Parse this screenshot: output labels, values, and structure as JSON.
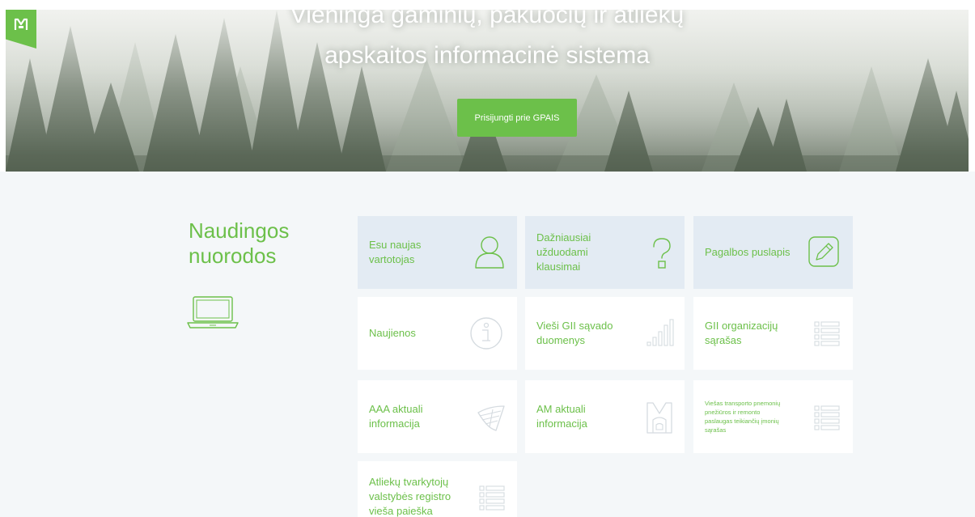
{
  "hero": {
    "title_line1": "Vieninga gaminių, pakuočių ir atliekų",
    "title_line2": "apskaitos informacinė sistema",
    "login_button": "Prisijungti prie GPAIS"
  },
  "logo": {
    "icon": "gpais-logo-icon"
  },
  "links_section": {
    "title": "Naudingos nuorodos",
    "icon": "laptop-icon",
    "cards": [
      {
        "label": "Esu naujas vartotojas",
        "icon": "user-icon",
        "highlighted": true
      },
      {
        "label": "Dažniausiai užduodami klausimai",
        "icon": "question-icon",
        "highlighted": true
      },
      {
        "label": "Pagalbos puslapis",
        "icon": "pencil-icon",
        "highlighted": true
      },
      {
        "label": "Naujienos",
        "icon": "info-icon",
        "highlighted": false
      },
      {
        "label": "Vieši GII sąvado duomenys",
        "icon": "bar-chart-icon",
        "highlighted": false
      },
      {
        "label": "GII organizacijų sąrašas",
        "icon": "list-icon",
        "highlighted": false
      },
      {
        "label": "AAA aktuali informacija",
        "icon": "aaa-logo-icon",
        "highlighted": false
      },
      {
        "label": "AM aktuali informacija",
        "icon": "am-logo-icon",
        "highlighted": false
      },
      {
        "label": "Viešas transporto pnemonių pnežiūros ir remonto paslaugas teikiančių įmonių sąrašas",
        "icon": "list-icon",
        "highlighted": false
      },
      {
        "label": "Atliekų tvarkytojų valstybės registro vieša paieška",
        "icon": "list-icon",
        "highlighted": false
      }
    ]
  },
  "colors": {
    "accent_green": "#6cc04a",
    "card_highlight": "#e3ebf3",
    "content_background": "#f4f7f9",
    "icon_stroke": "#d5dbe0"
  }
}
